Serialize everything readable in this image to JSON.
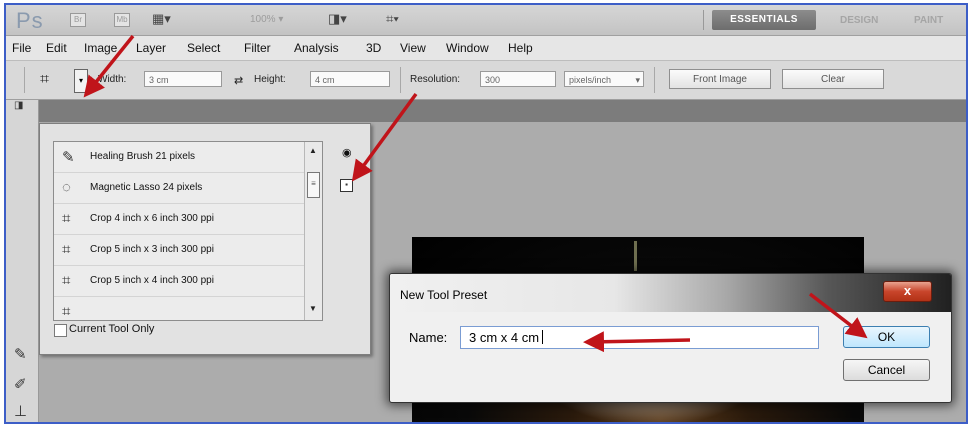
{
  "appbar": {
    "logo": "Ps",
    "btn_br": "Br",
    "btn_mb": "Mb",
    "screen_mode_icon": "screen-mode-icon",
    "zoom": "100%",
    "workspaces": [
      "ESSENTIALS",
      "DESIGN",
      "PAINT"
    ]
  },
  "menubar": {
    "items": [
      "File",
      "Edit",
      "Image",
      "Layer",
      "Select",
      "Filter",
      "Analysis",
      "3D",
      "View",
      "Window",
      "Help"
    ]
  },
  "options": {
    "width_label": "Width:",
    "width_value": "3 cm",
    "height_label": "Height:",
    "height_value": "4 cm",
    "resolution_label": "Resolution:",
    "resolution_value": "300",
    "resolution_unit": "pixels/inch",
    "front_image": "Front Image",
    "clear": "Clear"
  },
  "preset_panel": {
    "presets": [
      {
        "icon": "healing-brush-icon",
        "label": "Healing Brush 21 pixels"
      },
      {
        "icon": "magnetic-lasso-icon",
        "label": "Magnetic Lasso 24 pixels"
      },
      {
        "icon": "crop-icon",
        "label": "Crop 4 inch x 6 inch 300 ppi"
      },
      {
        "icon": "crop-icon",
        "label": "Crop 5 inch x 3 inch 300 ppi"
      },
      {
        "icon": "crop-icon",
        "label": "Crop 5 inch x 4 inch 300 ppi"
      }
    ],
    "current_tool_only": "Current Tool Only"
  },
  "dialog": {
    "title": "New Tool Preset",
    "close": "x",
    "name_label": "Name:",
    "name_value": "3 cm x 4 cm",
    "ok": "OK",
    "cancel": "Cancel"
  },
  "colors": {
    "arrow": "#c0141a",
    "frame_border": "#3d5ec7",
    "close_button": "#c8452b"
  }
}
